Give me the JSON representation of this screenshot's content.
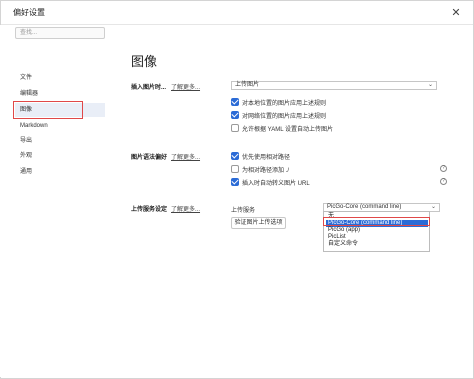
{
  "window": {
    "title": "偏好设置",
    "close_label": "✕"
  },
  "sidebar": {
    "search_placeholder": "查找...",
    "items": [
      {
        "label": "文件"
      },
      {
        "label": "编辑器"
      },
      {
        "label": "图像"
      },
      {
        "label": "Markdown"
      },
      {
        "label": "导出"
      },
      {
        "label": "外观"
      },
      {
        "label": "通用"
      }
    ],
    "active_index": 2
  },
  "main": {
    "heading": "图像",
    "insert": {
      "title": "插入图片时...",
      "learn_more": "了解更多...",
      "select_value": "上传图片",
      "options": [
        {
          "label": "对本地位置的图片应用上述规则",
          "checked": true
        },
        {
          "label": "对网络位置的图片应用上述规则",
          "checked": true
        },
        {
          "label": "允许根据 YAML 设置自动上传图片",
          "checked": false
        }
      ]
    },
    "syntax": {
      "title": "图片语法偏好",
      "learn_more": "了解更多...",
      "options": [
        {
          "label": "优先使用相对路径",
          "checked": true,
          "help": false
        },
        {
          "label": "为相对路径添加 ./",
          "checked": false,
          "help": true
        },
        {
          "label": "插入时自动转义图片 URL",
          "checked": true,
          "help": true
        }
      ],
      "help_label": "?"
    },
    "upload": {
      "title": "上传服务设定",
      "learn_more": "了解更多...",
      "service_label": "上传服务",
      "select_value": "PicGo-Core (command line)",
      "validate_button": "验证图片上传选项",
      "dropdown_options": [
        {
          "label": "无",
          "selected": false
        },
        {
          "label": "PicGo-Core (command line)",
          "selected": true
        },
        {
          "label": "PicGo (app)",
          "selected": false
        },
        {
          "label": "PicList",
          "selected": false
        },
        {
          "label": "自定义命令",
          "selected": false
        }
      ]
    }
  },
  "colors": {
    "accent": "#2b6bd6",
    "highlight": "#e04848"
  }
}
